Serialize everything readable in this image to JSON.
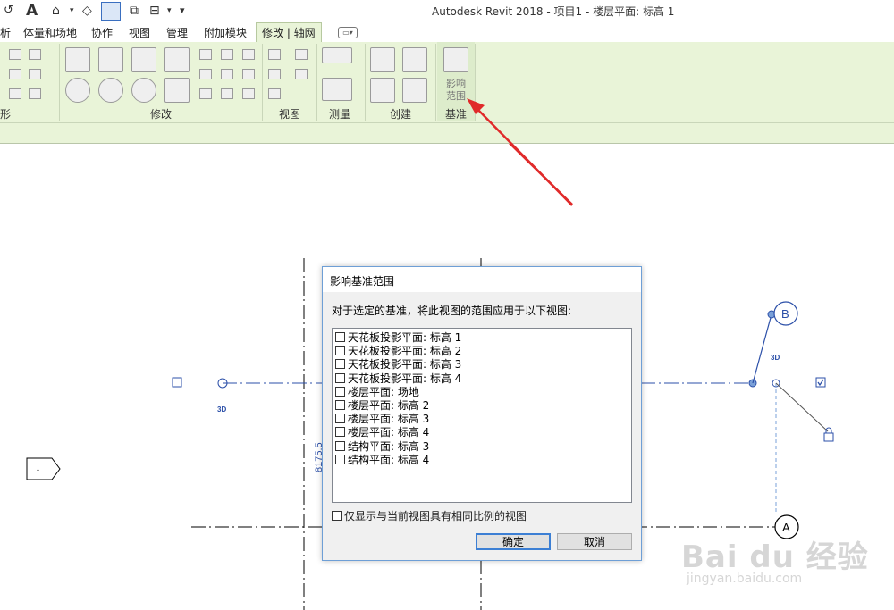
{
  "window": {
    "title": "Autodesk Revit 2018 -    项目1 - 楼层平面: 标高 1"
  },
  "quick_access": {
    "text_tool_glyph": "A",
    "overflow_glyph": "▾"
  },
  "tabs": [
    {
      "label": "析"
    },
    {
      "label": "体量和场地"
    },
    {
      "label": "协作"
    },
    {
      "label": "视图"
    },
    {
      "label": "管理"
    },
    {
      "label": "附加模块"
    },
    {
      "label": "修改 | 轴网",
      "active": true
    }
  ],
  "tab_dropdown_glyph": "▭▾",
  "ribbon": {
    "panels": [
      {
        "label": "形"
      },
      {
        "label": "修改"
      },
      {
        "label": "视图"
      },
      {
        "label": "测量"
      },
      {
        "label": "创建"
      },
      {
        "label": "基准"
      }
    ],
    "influence_extents_label_1": "影响",
    "influence_extents_label_2": "范围"
  },
  "drawing": {
    "grid_bubble_b": "B",
    "grid_bubble_a": "A",
    "label_3d_left": "3D",
    "label_3d_right": "3D",
    "dimension_text": "8175.5"
  },
  "dialog": {
    "title": "影响基准范围",
    "instruction": "对于选定的基准，将此视图的范围应用于以下视图:",
    "views": [
      {
        "label": "天花板投影平面: 标高 1",
        "checked": false
      },
      {
        "label": "天花板投影平面: 标高 2",
        "checked": false
      },
      {
        "label": "天花板投影平面: 标高 3",
        "checked": false
      },
      {
        "label": "天花板投影平面: 标高 4",
        "checked": false
      },
      {
        "label": "楼层平面: 场地",
        "checked": false
      },
      {
        "label": "楼层平面: 标高 2",
        "checked": false
      },
      {
        "label": "楼层平面: 标高 3",
        "checked": false
      },
      {
        "label": "楼层平面: 标高 4",
        "checked": false
      },
      {
        "label": "结构平面: 标高 3",
        "checked": false
      },
      {
        "label": "结构平面: 标高 4",
        "checked": false
      }
    ],
    "same_scale_label": "仅显示与当前视图具有相同比例的视图",
    "ok_label": "确定",
    "cancel_label": "取消"
  },
  "watermark": {
    "brand": "Bai du 经验",
    "url": "jingyan.baidu.com"
  },
  "colors": {
    "ribbon_bg": "#e9f4d8",
    "grid_blue": "#2b4fa8",
    "annotation_red": "#e02a2a",
    "dialog_border": "#6e9fd6"
  }
}
